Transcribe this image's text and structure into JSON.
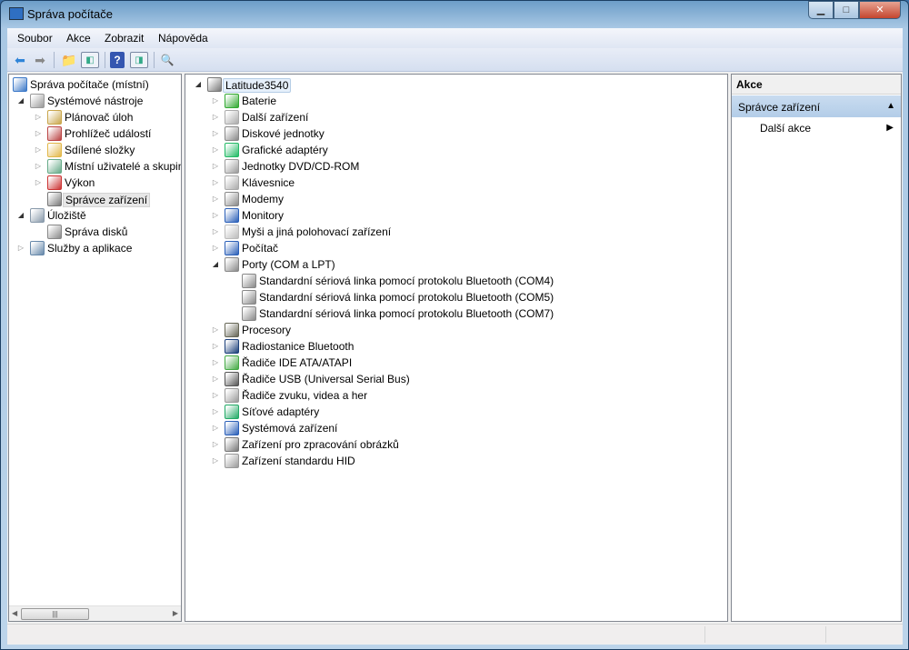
{
  "window": {
    "title": "Správa počítače"
  },
  "menu": [
    "Soubor",
    "Akce",
    "Zobrazit",
    "Nápověda"
  ],
  "menu_underline": [
    "S",
    "A",
    "Z",
    "N"
  ],
  "toolbar": [
    "back-icon",
    "forward-icon",
    "up-folder-icon",
    "show-hide-console-tree-icon",
    "help-icon",
    "show-hide-action-pane-icon",
    "scan-hardware-icon"
  ],
  "left_tree": [
    {
      "label": "Správa počítače (místní)",
      "depth": 0,
      "exp": "",
      "icon": "computer-management-icon",
      "color": "#3b78c8"
    },
    {
      "label": "Systémové nástroje",
      "depth": 1,
      "exp": "open",
      "icon": "tools-icon",
      "color": "#999"
    },
    {
      "label": "Plánovač úloh",
      "depth": 2,
      "exp": "closed",
      "icon": "clock-icon",
      "color": "#c9a64b"
    },
    {
      "label": "Prohlížeč událostí",
      "depth": 2,
      "exp": "closed",
      "icon": "event-viewer-icon",
      "color": "#b44"
    },
    {
      "label": "Sdílené složky",
      "depth": 2,
      "exp": "closed",
      "icon": "shared-folder-icon",
      "color": "#e2b84a"
    },
    {
      "label": "Místní uživatelé a skupiny",
      "depth": 2,
      "exp": "closed",
      "icon": "users-icon",
      "color": "#6a8"
    },
    {
      "label": "Výkon",
      "depth": 2,
      "exp": "closed",
      "icon": "performance-icon",
      "color": "#c33"
    },
    {
      "label": "Správce zařízení",
      "depth": 2,
      "exp": "",
      "icon": "device-manager-icon",
      "color": "#777",
      "selected": true
    },
    {
      "label": "Úložiště",
      "depth": 1,
      "exp": "open",
      "icon": "storage-icon",
      "color": "#89a"
    },
    {
      "label": "Správa disků",
      "depth": 2,
      "exp": "",
      "icon": "disk-icon",
      "color": "#888"
    },
    {
      "label": "Služby a aplikace",
      "depth": 1,
      "exp": "closed",
      "icon": "services-icon",
      "color": "#68a"
    }
  ],
  "device_tree": [
    {
      "label": "Latitude3540",
      "depth": 0,
      "exp": "open",
      "icon": "computer-icon",
      "color": "#777",
      "selected": true
    },
    {
      "label": "Baterie",
      "depth": 1,
      "exp": "closed",
      "icon": "battery-icon",
      "color": "#3a3"
    },
    {
      "label": "Další zařízení",
      "depth": 1,
      "exp": "closed",
      "icon": "unknown-device-icon",
      "color": "#aaa"
    },
    {
      "label": "Diskové jednotky",
      "depth": 1,
      "exp": "closed",
      "icon": "disk-drive-icon",
      "color": "#888"
    },
    {
      "label": "Grafické adaptéry",
      "depth": 1,
      "exp": "closed",
      "icon": "display-adapter-icon",
      "color": "#2b6"
    },
    {
      "label": "Jednotky DVD/CD-ROM",
      "depth": 1,
      "exp": "closed",
      "icon": "dvd-icon",
      "color": "#999"
    },
    {
      "label": "Klávesnice",
      "depth": 1,
      "exp": "closed",
      "icon": "keyboard-icon",
      "color": "#aaa"
    },
    {
      "label": "Modemy",
      "depth": 1,
      "exp": "closed",
      "icon": "modem-icon",
      "color": "#888"
    },
    {
      "label": "Monitory",
      "depth": 1,
      "exp": "closed",
      "icon": "monitor-icon",
      "color": "#2a5fb8"
    },
    {
      "label": "Myši a jiná polohovací zařízení",
      "depth": 1,
      "exp": "closed",
      "icon": "mouse-icon",
      "color": "#bbb"
    },
    {
      "label": "Počítač",
      "depth": 1,
      "exp": "closed",
      "icon": "pc-icon",
      "color": "#2a5fb8"
    },
    {
      "label": "Porty (COM a LPT)",
      "depth": 1,
      "exp": "open",
      "icon": "port-icon",
      "color": "#888"
    },
    {
      "label": "Standardní sériová linka pomocí protokolu Bluetooth (COM4)",
      "depth": 2,
      "exp": "",
      "icon": "port-icon",
      "color": "#888"
    },
    {
      "label": "Standardní sériová linka pomocí protokolu Bluetooth (COM5)",
      "depth": 2,
      "exp": "",
      "icon": "port-icon",
      "color": "#888"
    },
    {
      "label": "Standardní sériová linka pomocí protokolu Bluetooth (COM7)",
      "depth": 2,
      "exp": "",
      "icon": "port-icon",
      "color": "#888"
    },
    {
      "label": "Procesory",
      "depth": 1,
      "exp": "closed",
      "icon": "processor-icon",
      "color": "#665"
    },
    {
      "label": "Radiostanice Bluetooth",
      "depth": 1,
      "exp": "closed",
      "icon": "bluetooth-icon",
      "color": "#1b3f7a"
    },
    {
      "label": "Řadiče IDE ATA/ATAPI",
      "depth": 1,
      "exp": "closed",
      "icon": "ide-icon",
      "color": "#4a4"
    },
    {
      "label": "Řadiče USB (Universal Serial Bus)",
      "depth": 1,
      "exp": "closed",
      "icon": "usb-icon",
      "color": "#555"
    },
    {
      "label": "Řadiče zvuku, videa a her",
      "depth": 1,
      "exp": "closed",
      "icon": "sound-icon",
      "color": "#999"
    },
    {
      "label": "Síťové adaptéry",
      "depth": 1,
      "exp": "closed",
      "icon": "network-icon",
      "color": "#2a6"
    },
    {
      "label": "Systémová zařízení",
      "depth": 1,
      "exp": "closed",
      "icon": "system-devices-icon",
      "color": "#2a5fb8"
    },
    {
      "label": "Zařízení pro zpracování obrázků",
      "depth": 1,
      "exp": "closed",
      "icon": "camera-icon",
      "color": "#777"
    },
    {
      "label": "Zařízení standardu HID",
      "depth": 1,
      "exp": "closed",
      "icon": "hid-icon",
      "color": "#999"
    }
  ],
  "actions": {
    "header": "Akce",
    "group": "Správce zařízení",
    "item": "Další akce"
  }
}
